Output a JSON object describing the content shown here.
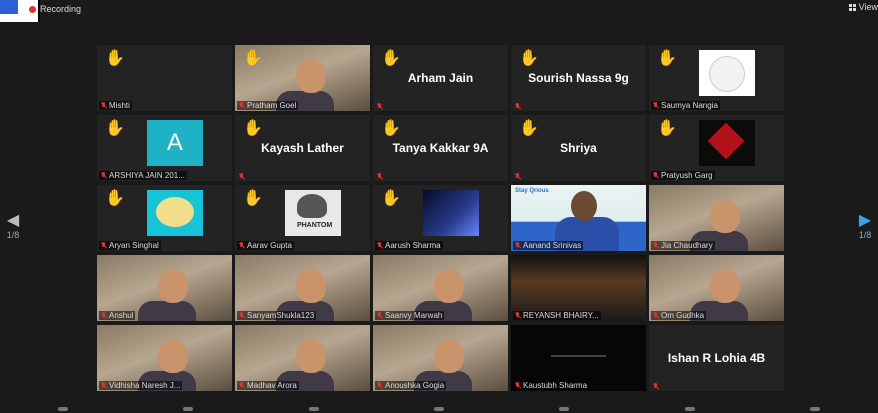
{
  "topbar": {
    "recording_label": "Recording",
    "view_label": "View"
  },
  "pagination": {
    "left": "1/8",
    "right": "1/8"
  },
  "colors": {
    "muted": "#d33333",
    "active_speaker": "#a5d34b",
    "hand": "#f6c33a"
  },
  "tiles": [
    {
      "name": "Mishti",
      "hand": true,
      "big": ""
    },
    {
      "name": "Pratham Goel",
      "hand": true,
      "big": "",
      "video": "webcam"
    },
    {
      "name": "",
      "hand": true,
      "big": "Arham Jain"
    },
    {
      "name": "",
      "hand": true,
      "big": "Sourish Nassa 9g"
    },
    {
      "name": "Saumya Nangia",
      "hand": true,
      "big": "",
      "avatar": "bear"
    },
    {
      "name": "ARSHIYA JAIN 201...",
      "hand": true,
      "big": "",
      "avatar": "letter",
      "avatar_letter": "A"
    },
    {
      "name": "",
      "hand": true,
      "big": "Kayash Lather"
    },
    {
      "name": "",
      "hand": true,
      "big": "Tanya Kakkar 9A"
    },
    {
      "name": "",
      "hand": true,
      "big": "Shriya"
    },
    {
      "name": "Pratyush Garg",
      "hand": true,
      "big": "",
      "avatar": "red-logo"
    },
    {
      "name": "Aryan Singhal",
      "hand": true,
      "big": "",
      "avatar": "potato"
    },
    {
      "name": "Aarav Gupta",
      "hand": true,
      "big": "",
      "avatar": "phantom",
      "avatar_text": "PHANTOM"
    },
    {
      "name": "Aarush Sharma",
      "hand": true,
      "big": "",
      "avatar": "jet"
    },
    {
      "name": "Aanand Srinivas",
      "hand": false,
      "big": "",
      "video": "host",
      "active": true,
      "brand": "Stay Qrious"
    },
    {
      "name": "Jia Chaudhary",
      "hand": false,
      "big": "",
      "video": "webcam"
    },
    {
      "name": "Anshul",
      "hand": false,
      "big": "",
      "video": "webcam"
    },
    {
      "name": "SanyamShukla123",
      "hand": false,
      "big": "",
      "video": "webcam"
    },
    {
      "name": "Saanvy Marwah",
      "hand": false,
      "big": "",
      "video": "webcam"
    },
    {
      "name": "REYANSH BHAIRY...",
      "hand": false,
      "big": "",
      "video": "dark"
    },
    {
      "name": "Om Gudhka",
      "hand": false,
      "big": "",
      "video": "webcam"
    },
    {
      "name": "Vidhisha Naresh J...",
      "hand": false,
      "big": "",
      "video": "webcam"
    },
    {
      "name": "Madhav Arora",
      "hand": false,
      "big": "",
      "video": "webcam"
    },
    {
      "name": "Anoushka Gogia",
      "hand": false,
      "big": "",
      "video": "webcam"
    },
    {
      "name": "Kaustubh Sharma",
      "hand": false,
      "big": "",
      "video": "black"
    },
    {
      "name": "",
      "hand": false,
      "big": "Ishan R Lohia 4B"
    }
  ]
}
